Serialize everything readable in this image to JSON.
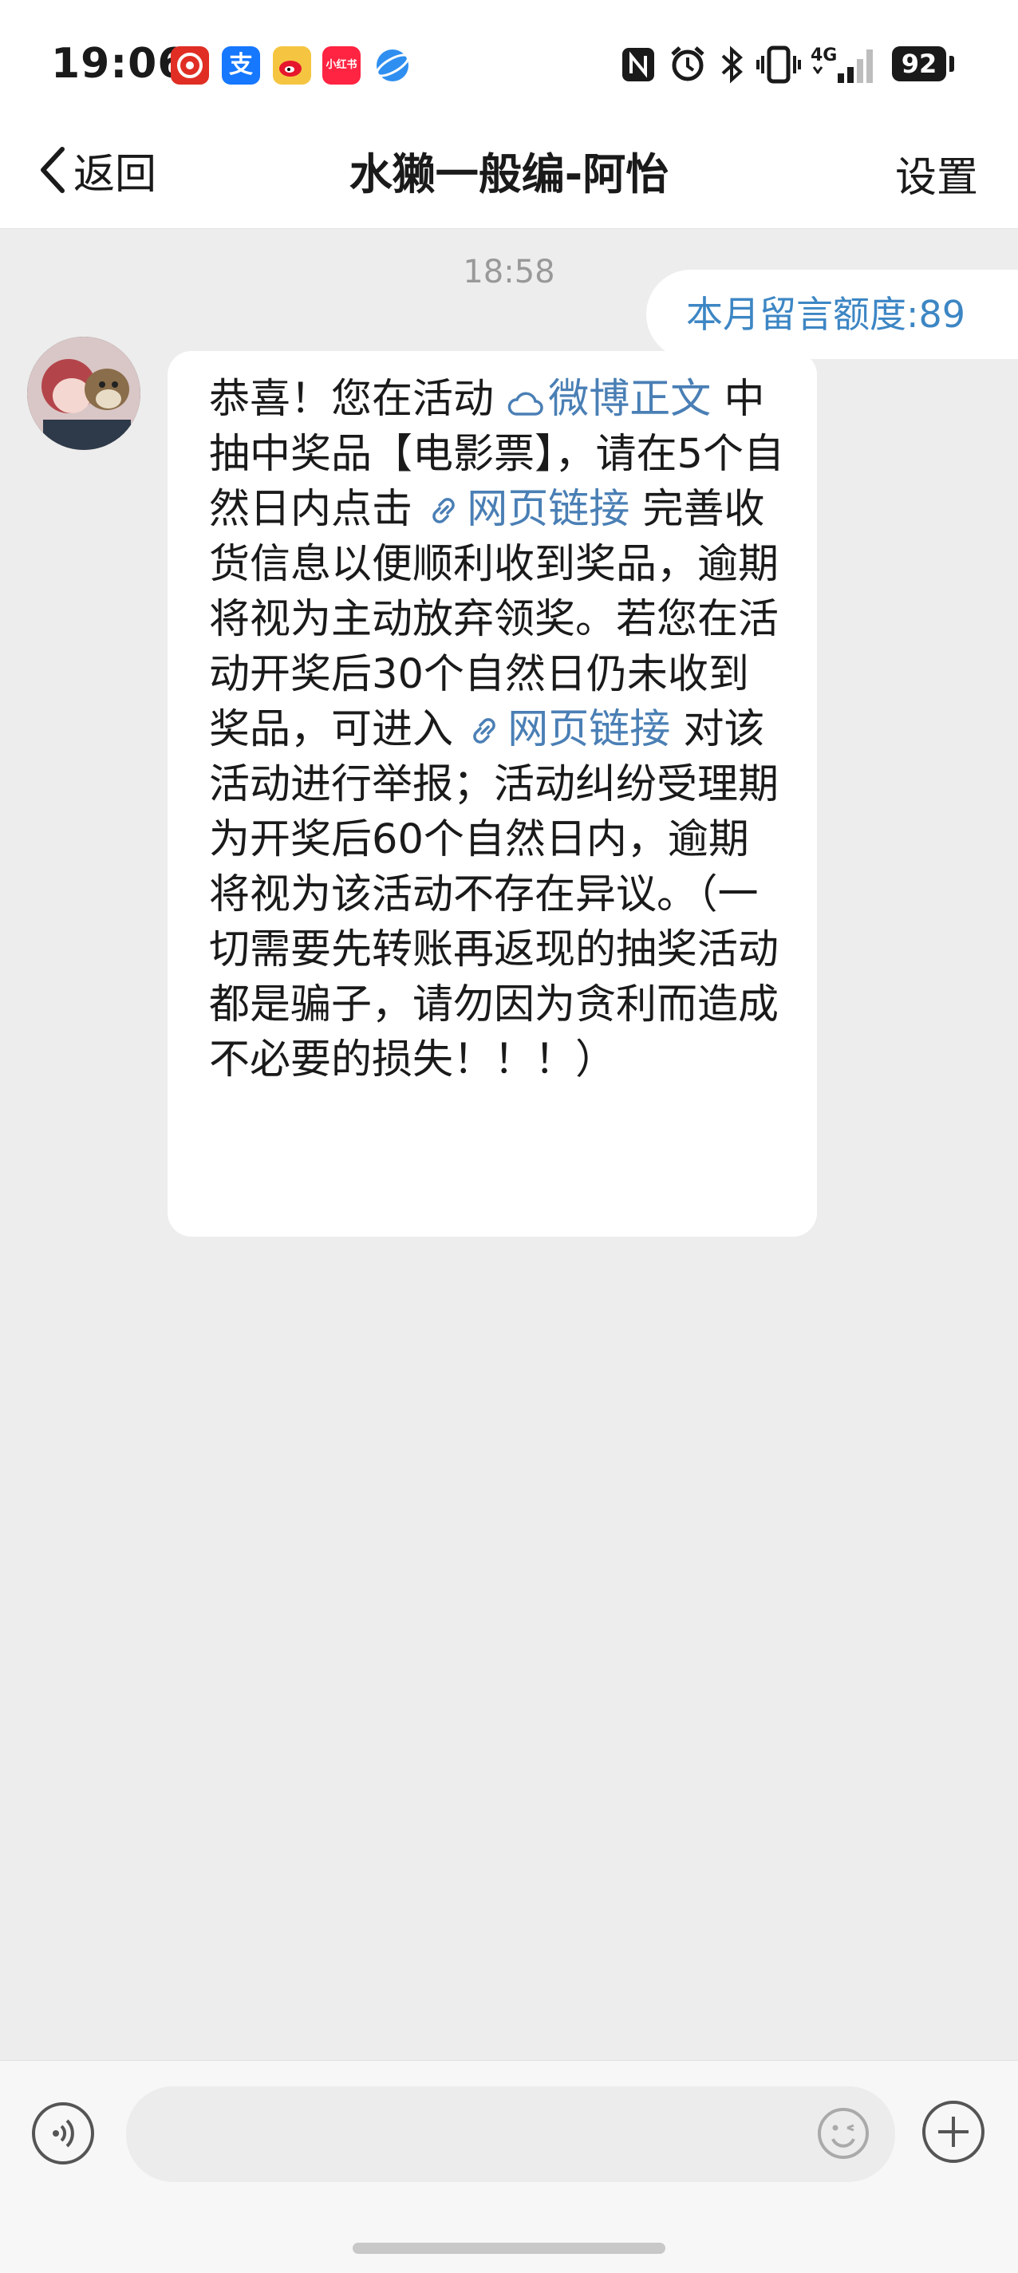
{
  "status_bar": {
    "time": "19:06",
    "battery": "92",
    "network": "4G",
    "apps": [
      {
        "icon": "pinduoduo-icon",
        "color": "#e02e24"
      },
      {
        "icon": "alipay-icon",
        "color": "#1677ff",
        "text": "支"
      },
      {
        "icon": "weibo-icon",
        "color": "#f5c542"
      },
      {
        "icon": "xiaohongshu-icon",
        "color": "#ff2442",
        "text": "小红书"
      },
      {
        "icon": "browser-icon",
        "color": "#2f8ff0"
      }
    ]
  },
  "navbar": {
    "back_label": "返回",
    "title": "水獭一般编-阿怡",
    "settings_label": "设置"
  },
  "chat": {
    "timestamp": "18:58",
    "quota_label": "本月留言额度:89",
    "message": {
      "seg1": "恭喜！您在活动 ",
      "link1": "微博正文",
      "seg2": " 中抽中奖品【电影票】，请在5个自然日内点击 ",
      "link2": "网页链接",
      "seg3": " 完善收货信息以便顺利收到奖品，逾期将视为主动放弃领奖。若您在活动开奖后30个自然日仍未收到奖品，可进入 ",
      "link3": "网页链接",
      "seg4": " 对该活动进行举报；活动纠纷受理期为开奖后60个自然日内，逾期将视为该活动不存在异议。（一切需要先转账再返现的抽奖活动都是骗子，请勿因为贪利而造成不必要的损失！！！）"
    }
  },
  "colors": {
    "link": "#4a7fb5",
    "quota_text": "#3d86c4",
    "background": "#ededed"
  }
}
